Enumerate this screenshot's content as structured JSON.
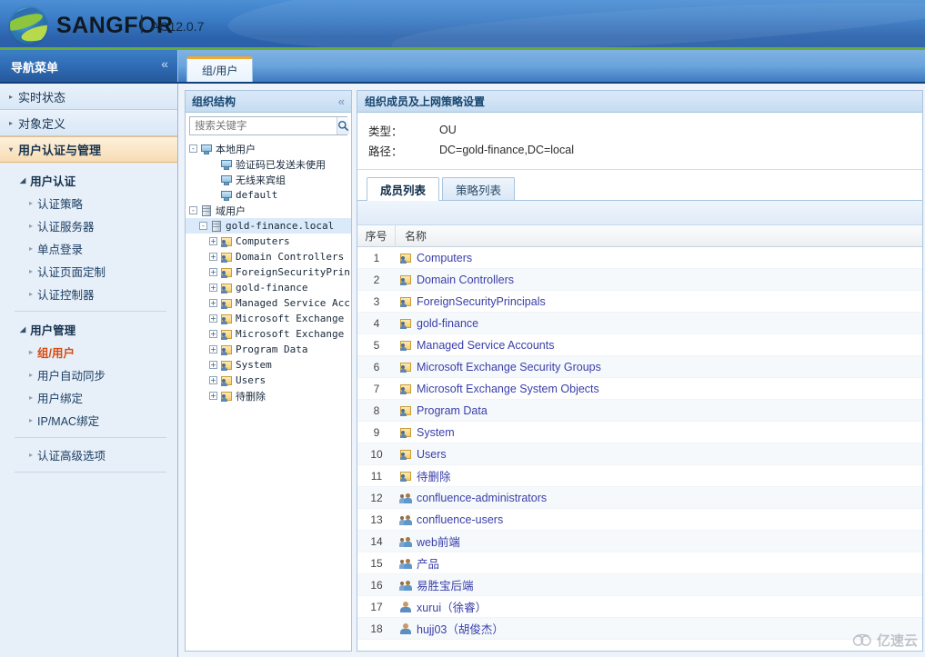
{
  "brand": {
    "name": "SANGFOR",
    "separator": "|",
    "version": "AC12.0.7"
  },
  "nav_header": {
    "title": "导航菜单",
    "collapse": "«"
  },
  "top_tabs": [
    {
      "label": "组/用户",
      "active": true
    }
  ],
  "sidebar": {
    "groups": [
      {
        "label": "实时状态",
        "active": false,
        "arrow": "▸"
      },
      {
        "label": "对象定义",
        "active": false,
        "arrow": "▸"
      },
      {
        "label": "用户认证与管理",
        "active": true,
        "arrow": "▾"
      }
    ],
    "sections": [
      {
        "label": "用户认证",
        "arrow": "◢",
        "items": [
          {
            "label": "认证策略",
            "selected": false
          },
          {
            "label": "认证服务器",
            "selected": false
          },
          {
            "label": "单点登录",
            "selected": false
          },
          {
            "label": "认证页面定制",
            "selected": false
          },
          {
            "label": "认证控制器",
            "selected": false
          }
        ]
      },
      {
        "label": "用户管理",
        "arrow": "◢",
        "items": [
          {
            "label": "组/用户",
            "selected": true
          },
          {
            "label": "用户自动同步",
            "selected": false
          },
          {
            "label": "用户绑定",
            "selected": false
          },
          {
            "label": "IP/MAC绑定",
            "selected": false
          }
        ]
      }
    ],
    "tail_items": [
      {
        "label": "认证高级选项"
      }
    ]
  },
  "tree_panel": {
    "title": "组织结构",
    "collapse": "«",
    "search": {
      "value": "",
      "placeholder": "搜索关键字"
    },
    "nodes": [
      {
        "label": "本地用户",
        "indent": 0,
        "toggle": "-",
        "icon": "monitor-icon",
        "selected": false
      },
      {
        "label": "验证码已发送未使用",
        "indent": 2,
        "toggle": "",
        "icon": "monitor-icon",
        "selected": false
      },
      {
        "label": "无线来宾组",
        "indent": 2,
        "toggle": "",
        "icon": "monitor-icon",
        "selected": false
      },
      {
        "label": "default",
        "indent": 2,
        "toggle": "",
        "icon": "monitor-icon",
        "selected": false
      },
      {
        "label": "域用户",
        "indent": 0,
        "toggle": "-",
        "icon": "server-icon",
        "selected": false
      },
      {
        "label": "gold-finance.local",
        "indent": 1,
        "toggle": "-",
        "icon": "server-icon",
        "selected": true
      },
      {
        "label": "Computers",
        "indent": 2,
        "toggle": "+",
        "icon": "ou-icon",
        "selected": false
      },
      {
        "label": "Domain Controllers",
        "indent": 2,
        "toggle": "+",
        "icon": "ou-icon",
        "selected": false
      },
      {
        "label": "ForeignSecurityPrincipals",
        "indent": 2,
        "toggle": "+",
        "icon": "ou-icon",
        "selected": false
      },
      {
        "label": "gold-finance",
        "indent": 2,
        "toggle": "+",
        "icon": "ou-icon",
        "selected": false
      },
      {
        "label": "Managed Service Accounts",
        "indent": 2,
        "toggle": "+",
        "icon": "ou-icon",
        "selected": false
      },
      {
        "label": "Microsoft Exchange Security Groups",
        "indent": 2,
        "toggle": "+",
        "icon": "ou-icon",
        "selected": false
      },
      {
        "label": "Microsoft Exchange System Objects",
        "indent": 2,
        "toggle": "+",
        "icon": "ou-icon",
        "selected": false
      },
      {
        "label": "Program Data",
        "indent": 2,
        "toggle": "+",
        "icon": "ou-icon",
        "selected": false
      },
      {
        "label": "System",
        "indent": 2,
        "toggle": "+",
        "icon": "ou-icon",
        "selected": false
      },
      {
        "label": "Users",
        "indent": 2,
        "toggle": "+",
        "icon": "ou-icon",
        "selected": false
      },
      {
        "label": "待删除",
        "indent": 2,
        "toggle": "+",
        "icon": "ou-icon",
        "selected": false
      }
    ]
  },
  "main": {
    "title": "组织成员及上网策略设置",
    "info": [
      {
        "label": "类型：",
        "value": "OU"
      },
      {
        "label": "路径：",
        "value": "DC=gold-finance,DC=local"
      }
    ],
    "tabs": [
      {
        "label": "成员列表",
        "active": true
      },
      {
        "label": "策略列表",
        "active": false
      }
    ],
    "table": {
      "columns": [
        "序号",
        "名称"
      ],
      "rows": [
        {
          "no": "1",
          "name": "Computers",
          "icon": "ou-icon"
        },
        {
          "no": "2",
          "name": "Domain Controllers",
          "icon": "ou-icon"
        },
        {
          "no": "3",
          "name": "ForeignSecurityPrincipals",
          "icon": "ou-icon"
        },
        {
          "no": "4",
          "name": "gold-finance",
          "icon": "ou-icon"
        },
        {
          "no": "5",
          "name": "Managed Service Accounts",
          "icon": "ou-icon"
        },
        {
          "no": "6",
          "name": "Microsoft Exchange Security Groups",
          "icon": "ou-icon"
        },
        {
          "no": "7",
          "name": "Microsoft Exchange System Objects",
          "icon": "ou-icon"
        },
        {
          "no": "8",
          "name": "Program Data",
          "icon": "ou-icon"
        },
        {
          "no": "9",
          "name": "System",
          "icon": "ou-icon"
        },
        {
          "no": "10",
          "name": "Users",
          "icon": "ou-icon"
        },
        {
          "no": "11",
          "name": "待删除",
          "icon": "ou-icon"
        },
        {
          "no": "12",
          "name": "confluence-administrators",
          "icon": "group-icon"
        },
        {
          "no": "13",
          "name": "confluence-users",
          "icon": "group-icon"
        },
        {
          "no": "14",
          "name": "web前端",
          "icon": "group-icon"
        },
        {
          "no": "15",
          "name": "产品",
          "icon": "group-icon"
        },
        {
          "no": "16",
          "name": "易胜宝后端",
          "icon": "group-icon"
        },
        {
          "no": "17",
          "name": "xurui（徐睿）",
          "icon": "user-icon"
        },
        {
          "no": "18",
          "name": "hujj03（胡俊杰）",
          "icon": "user-icon"
        }
      ]
    }
  },
  "watermark": {
    "text": "亿速云"
  },
  "colors": {
    "brand_blue": "#2c63ad",
    "accent_orange": "#f0a830",
    "selected_red": "#d94a0e",
    "link_blue": "#3a3fa8",
    "green_rule": "#6aab37"
  }
}
